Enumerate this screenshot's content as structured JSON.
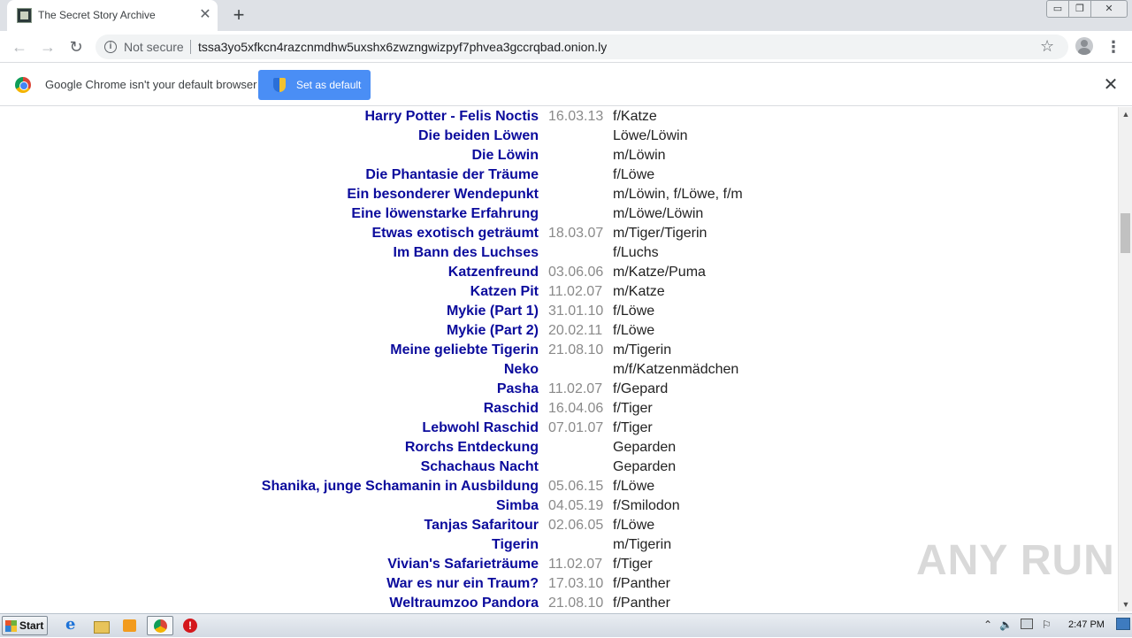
{
  "browser": {
    "tab_title": "The Secret Story Archive",
    "tab_close": "✕",
    "new_tab": "+",
    "not_secure": "Not secure",
    "url": "tssa3yo5xfkcn4razcnmdhw5uxshx6zwzngwizpyf7phvea3gccrqbad.onion.ly",
    "back": "←",
    "forward": "→",
    "reload": "↻",
    "star": "☆",
    "menu": "⋮",
    "win_min": "▭",
    "win_max": "❐",
    "win_close": "✕"
  },
  "infobar": {
    "message": "Google Chrome isn't your default browser",
    "button_label": "Set as default",
    "close": "✕"
  },
  "stories": [
    {
      "title": "Harry Potter - Felis Noctis",
      "date": "16.03.13",
      "tags": "f/Katze"
    },
    {
      "title": "Die beiden Löwen",
      "date": "",
      "tags": "Löwe/Löwin"
    },
    {
      "title": "Die Löwin",
      "date": "",
      "tags": "m/Löwin"
    },
    {
      "title": "Die Phantasie der Träume",
      "date": "",
      "tags": "f/Löwe"
    },
    {
      "title": "Ein besonderer Wendepunkt",
      "date": "",
      "tags": "m/Löwin, f/Löwe, f/m"
    },
    {
      "title": "Eine löwenstarke Erfahrung",
      "date": "",
      "tags": "m/Löwe/Löwin"
    },
    {
      "title": "Etwas exotisch geträumt",
      "date": "18.03.07",
      "tags": "m/Tiger/Tigerin"
    },
    {
      "title": "Im Bann des Luchses",
      "date": "",
      "tags": "f/Luchs"
    },
    {
      "title": "Katzenfreund",
      "date": "03.06.06",
      "tags": "m/Katze/Puma"
    },
    {
      "title": "Katzen Pit",
      "date": "11.02.07",
      "tags": "m/Katze"
    },
    {
      "title": "Mykie (Part 1)",
      "date": "31.01.10",
      "tags": "f/Löwe"
    },
    {
      "title": "Mykie (Part 2)",
      "date": "20.02.11",
      "tags": "f/Löwe"
    },
    {
      "title": "Meine geliebte Tigerin",
      "date": "21.08.10",
      "tags": "m/Tigerin"
    },
    {
      "title": "Neko",
      "date": "",
      "tags": "m/f/Katzenmädchen"
    },
    {
      "title": "Pasha",
      "date": "11.02.07",
      "tags": "f/Gepard"
    },
    {
      "title": "Raschid",
      "date": "16.04.06",
      "tags": "f/Tiger"
    },
    {
      "title": "Lebwohl Raschid",
      "date": "07.01.07",
      "tags": "f/Tiger"
    },
    {
      "title": "Rorchs Entdeckung",
      "date": "",
      "tags": "Geparden"
    },
    {
      "title": "Schachaus Nacht",
      "date": "",
      "tags": "Geparden"
    },
    {
      "title": "Shanika, junge Schamanin in Ausbildung",
      "date": "05.06.15",
      "tags": "f/Löwe"
    },
    {
      "title": "Simba",
      "date": "04.05.19",
      "tags": "f/Smilodon"
    },
    {
      "title": "Tanjas Safaritour",
      "date": "02.06.05",
      "tags": "f/Löwe"
    },
    {
      "title": "Tigerin",
      "date": "",
      "tags": "m/Tigerin"
    },
    {
      "title": "Vivian's Safarieträume",
      "date": "11.02.07",
      "tags": "f/Tiger"
    },
    {
      "title": "War es nur ein Traum?",
      "date": "17.03.10",
      "tags": "f/Panther"
    },
    {
      "title": "Weltraumzoo Pandora",
      "date": "21.08.10",
      "tags": "f/Panther"
    }
  ],
  "watermark": "ANY RUN",
  "taskbar": {
    "start_label": "Start",
    "clock": "2:47 PM",
    "tray_arrow": "⌃",
    "tray_volume": "🔈",
    "tray_flag": "⚐"
  },
  "scrollbar": {
    "up": "▲",
    "down": "▼"
  }
}
